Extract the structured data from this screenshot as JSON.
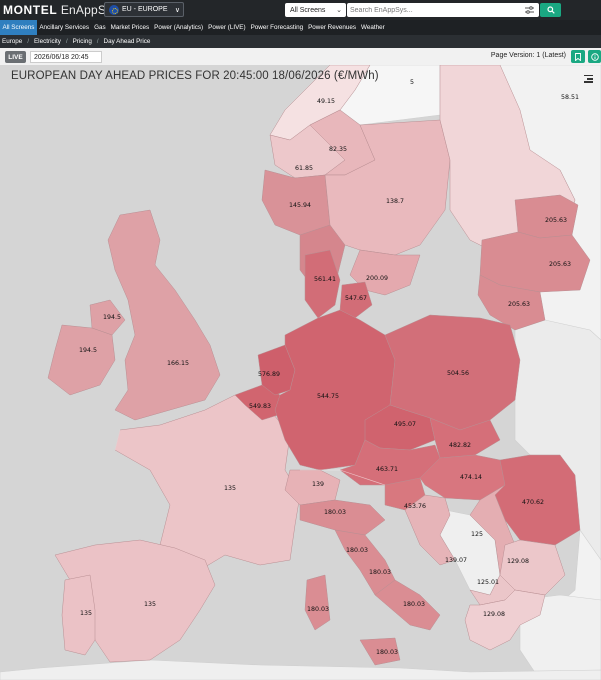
{
  "header": {
    "logo_brand": "MONTEL",
    "logo_product": "EnAppSys",
    "region_selector": "EU - EUROPE",
    "screens_selector": "All Screens",
    "search_placeholder": "Search EnAppSys..."
  },
  "nav": {
    "items": [
      {
        "label": "All Screens",
        "active": true
      },
      {
        "label": "Ancillary Services"
      },
      {
        "label": "Gas"
      },
      {
        "label": "Market Prices"
      },
      {
        "label": "Power (Analytics)"
      },
      {
        "label": "Power (LIVE)"
      },
      {
        "label": "Power Forecasting"
      },
      {
        "label": "Power Revenues"
      },
      {
        "label": "Weather"
      }
    ]
  },
  "breadcrumb": [
    "Europe",
    "Electricity",
    "Pricing",
    "Day Ahead Price"
  ],
  "toolbar": {
    "live_label": "LIVE",
    "datetime": "2026/06/18 20:45",
    "page_version": "Page Version: 1 (Latest)"
  },
  "map": {
    "title": "EUROPEAN DAY AHEAD PRICES FOR 20:45:00 18/06/2026 (€/MWh)",
    "price_labels": [
      "49.15",
      "5",
      "58.51",
      "82.35",
      "61.85",
      "145.94",
      "138.7",
      "205.63",
      "205.63",
      "561.41",
      "200.09",
      "547.67",
      "205.63",
      "194.5",
      "194.5",
      "166.15",
      "576.89",
      "544.75",
      "504.56",
      "549.83",
      "495.07",
      "482.82",
      "463.71",
      "474.14",
      "135",
      "139",
      "470.62",
      "180.03",
      "453.76",
      "125",
      "180.03",
      "139.07",
      "129.08",
      "180.03",
      "125.01",
      "135",
      "135",
      "180.03",
      "180.03",
      "129.08",
      "180.03"
    ]
  },
  "colors": {
    "header_bg": "#232629",
    "nav_active": "#2f7fbf",
    "accent_green": "#1aa882",
    "sea": "#d5d5d5"
  }
}
